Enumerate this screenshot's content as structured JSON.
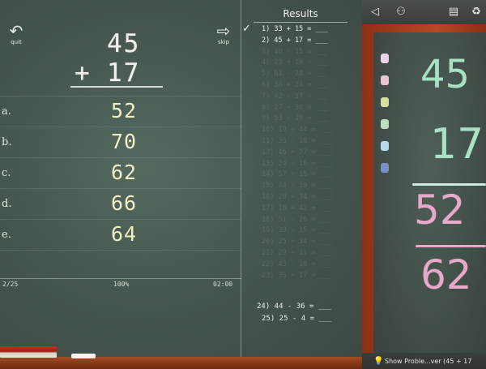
{
  "problem": {
    "nav": {
      "quit_label": "quit",
      "skip_label": "skip"
    },
    "top_number": "45",
    "operator": "+",
    "bottom_number": "17",
    "choices": [
      {
        "letter": "a.",
        "value": "52"
      },
      {
        "letter": "b.",
        "value": "70"
      },
      {
        "letter": "c.",
        "value": "62"
      },
      {
        "letter": "d.",
        "value": "66"
      },
      {
        "letter": "e.",
        "value": "64"
      }
    ]
  },
  "status": {
    "progress": "2/25",
    "percent": "100%",
    "time": "02:00"
  },
  "results": {
    "title": "Results",
    "items": [
      "1) 33 + 15 = ___",
      "2) 45 + 17 = ___",
      "3) 40 - 15 = ___",
      "4) 23 + 19 = ___",
      "5) 61 - 28 = ___",
      "6) 38 + 24 = ___",
      "7) 42 - 17 = ___",
      "8) 27 + 36 = ___",
      "9) 53 - 29 = ___",
      "10) 19 + 44 = ___",
      "11) 35 - 18 = ___",
      "12) 46 + 27 = ___",
      "13) 24 - 16 = ___",
      "14) 57 + 15 = ___",
      "15) 44 - 19 = ___",
      "16) 28 + 34 = ___",
      "17) 16 + 42 = ___",
      "18) 51 - 26 = ___",
      "19) 39 - 15 = ___",
      "20) 25 + 34 = ___",
      "21) 29 + 31 = ___",
      "22) 43 - 18 = ___",
      "23) 35 + 17 = ___"
    ],
    "bottom_items": [
      "24) 44 - 36 = ___",
      "25) 25 - 4 = ___"
    ]
  },
  "side": {
    "toolbar_icons": [
      "back-icon",
      "glasses-icon",
      "calculator-icon",
      "recycle-icon"
    ],
    "chalk_colors": [
      "#e9d3e0",
      "#e7c6cf",
      "#d9df9f",
      "#bfe0c0",
      "#b7d8ef",
      "#7b8fc8"
    ],
    "work": {
      "top": "45",
      "bottom": "17",
      "partial": "52",
      "answer": "62"
    },
    "show_problem_label": "Show Proble...ver (45 + 17"
  },
  "colors": {
    "chalk_green": "#a8e2c4",
    "chalk_pink": "#e8a9c9",
    "answer_yellow": "#f1efc4"
  }
}
